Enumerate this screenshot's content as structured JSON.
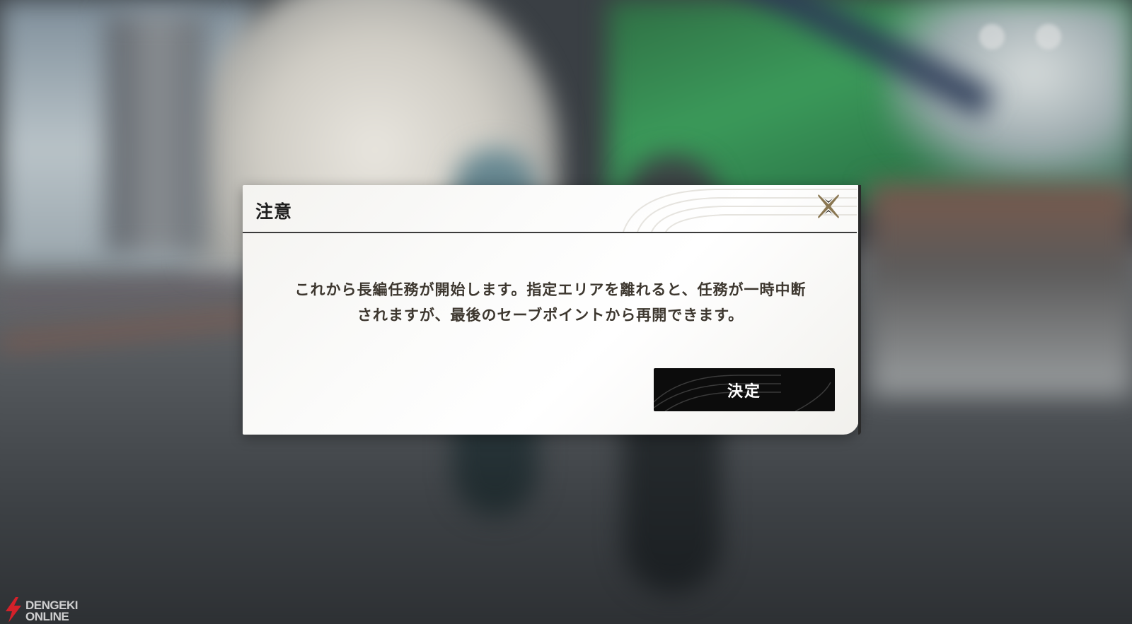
{
  "dialog": {
    "title": "注意",
    "message_line1": "これから長編任務が開始します。指定エリアを離れると、任務が一時中断",
    "message_line2": "されますが、最後のセーブポイントから再開できます。",
    "confirm_label": "決定",
    "close_icon": "close-x-icon"
  },
  "watermark": {
    "line1": "DENGEKI",
    "line2": "ONLINE"
  },
  "colors": {
    "dialog_bg": "#ffffff",
    "text": "#3d372f",
    "button_bg": "#0c0c0c",
    "close_accent": "#8a7752",
    "watermark_red": "#d4212a"
  }
}
